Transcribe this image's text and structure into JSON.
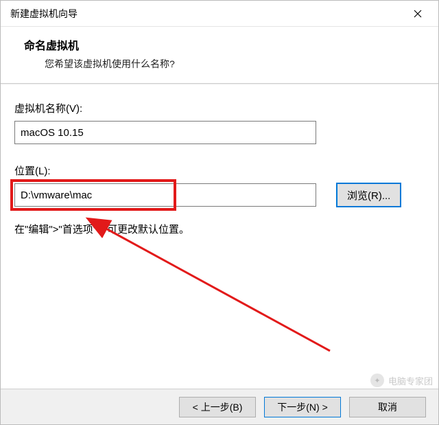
{
  "window": {
    "title": "新建虚拟机向导"
  },
  "header": {
    "title": "命名虚拟机",
    "subtitle": "您希望该虚拟机使用什么名称?"
  },
  "fields": {
    "name_label": "虚拟机名称(V):",
    "name_value": "macOS 10.15",
    "location_label": "位置(L):",
    "location_value": "D:\\vmware\\mac",
    "browse_label": "浏览(R)..."
  },
  "hint": "在\"编辑\">\"首选项\"中可更改默认位置。",
  "footer": {
    "back": "< 上一步(B)",
    "next": "下一步(N) >",
    "cancel": "取消"
  },
  "watermark": {
    "text": "电脑专家团"
  },
  "colors": {
    "highlight": "#e21a1a",
    "focus": "#0078d7"
  }
}
